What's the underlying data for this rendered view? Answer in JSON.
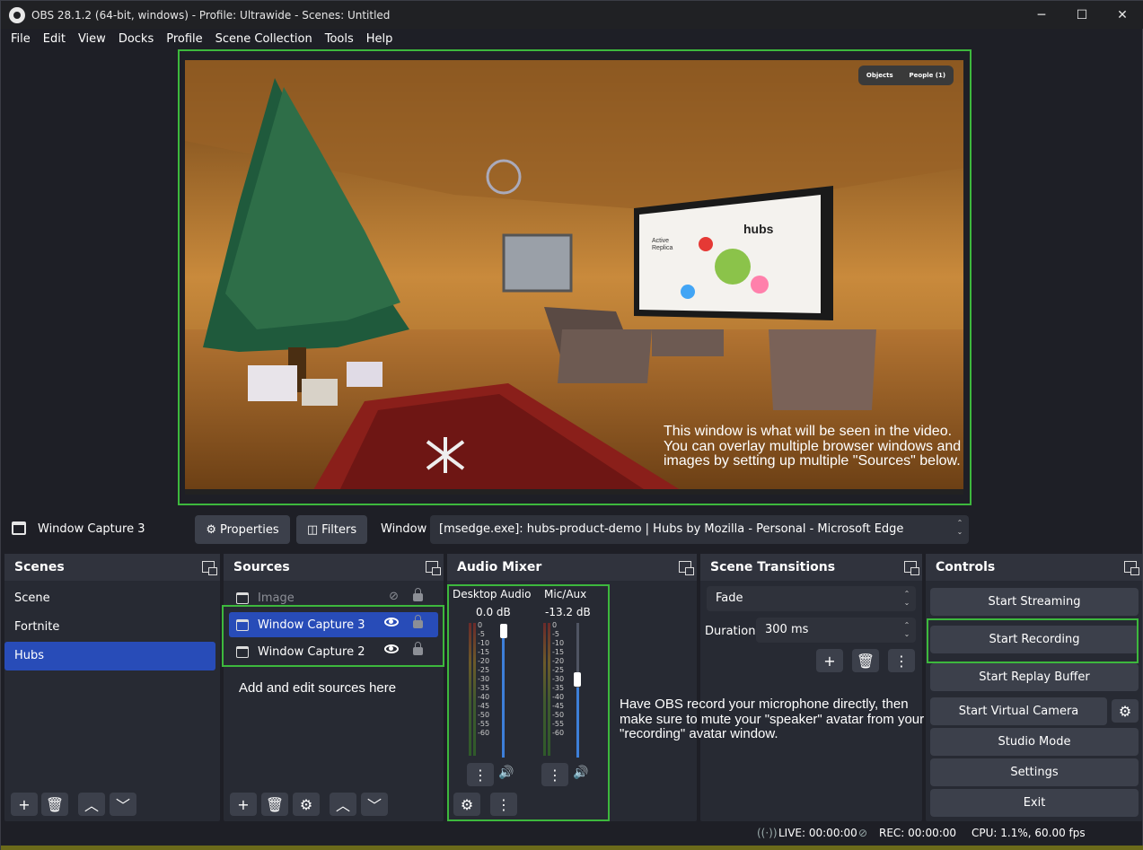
{
  "window": {
    "title": "OBS 28.1.2 (64-bit, windows) - Profile: Ultrawide - Scenes: Untitled",
    "minimize": "─",
    "maximize": "☐",
    "close": "✕"
  },
  "menu": [
    "File",
    "Edit",
    "View",
    "Docks",
    "Profile",
    "Scene Collection",
    "Tools",
    "Help"
  ],
  "preview": {
    "overlay_text": "This window is what will be seen in the video. You can overlay multiple browser windows and images by setting up multiple \"Sources\" below.",
    "hubs_toolbar": [
      "Objects",
      "People (1)"
    ],
    "screen_brand": "hubs",
    "screen_subbrand": "Active Replica"
  },
  "source_bar": {
    "name": "Window Capture 3",
    "properties_label": "Properties",
    "filters_label": "Filters",
    "window_label": "Window",
    "window_value": "[msedge.exe]: hubs-product-demo | Hubs by Mozilla - Personal - Microsoft Edge"
  },
  "scenes": {
    "title": "Scenes",
    "items": [
      "Scene",
      "Fortnite",
      "Hubs"
    ],
    "selected": "Hubs"
  },
  "sources": {
    "title": "Sources",
    "items": [
      {
        "name": "Image",
        "visible": false,
        "locked": true
      },
      {
        "name": "Window Capture 3",
        "visible": true,
        "locked": true
      },
      {
        "name": "Window Capture 2",
        "visible": true,
        "locked": true
      }
    ],
    "selected": "Window Capture 3",
    "annotation": "Add and edit sources here"
  },
  "audio_mixer": {
    "title": "Audio Mixer",
    "channels": [
      {
        "name": "Desktop Audio",
        "level": "0.0 dB"
      },
      {
        "name": "Mic/Aux",
        "level": "-13.2 dB"
      }
    ],
    "scale": [
      "0",
      "-5",
      "-10",
      "-15",
      "-20",
      "-25",
      "-30",
      "-35",
      "-40",
      "-45",
      "-50",
      "-55",
      "-60"
    ],
    "annotation": "Have OBS record your microphone directly, then make sure to mute your \"speaker\" avatar from your \"recording\" avatar window."
  },
  "scene_transitions": {
    "title": "Scene Transitions",
    "transition": "Fade",
    "duration_label": "Duration",
    "duration_value": "300 ms"
  },
  "controls": {
    "title": "Controls",
    "start_streaming": "Start Streaming",
    "start_recording": "Start Recording",
    "start_replay_buffer": "Start Replay Buffer",
    "start_virtual_camera": "Start Virtual Camera",
    "studio_mode": "Studio Mode",
    "settings": "Settings",
    "exit": "Exit"
  },
  "status": {
    "live": "LIVE: 00:00:00",
    "rec": "REC: 00:00:00",
    "cpu": "CPU: 1.1%, 60.00 fps"
  },
  "colors": {
    "accent_selected": "#284cb8",
    "highlight_green": "#3db83d",
    "panel_bg": "#272a33",
    "button_bg": "#3c404b"
  }
}
